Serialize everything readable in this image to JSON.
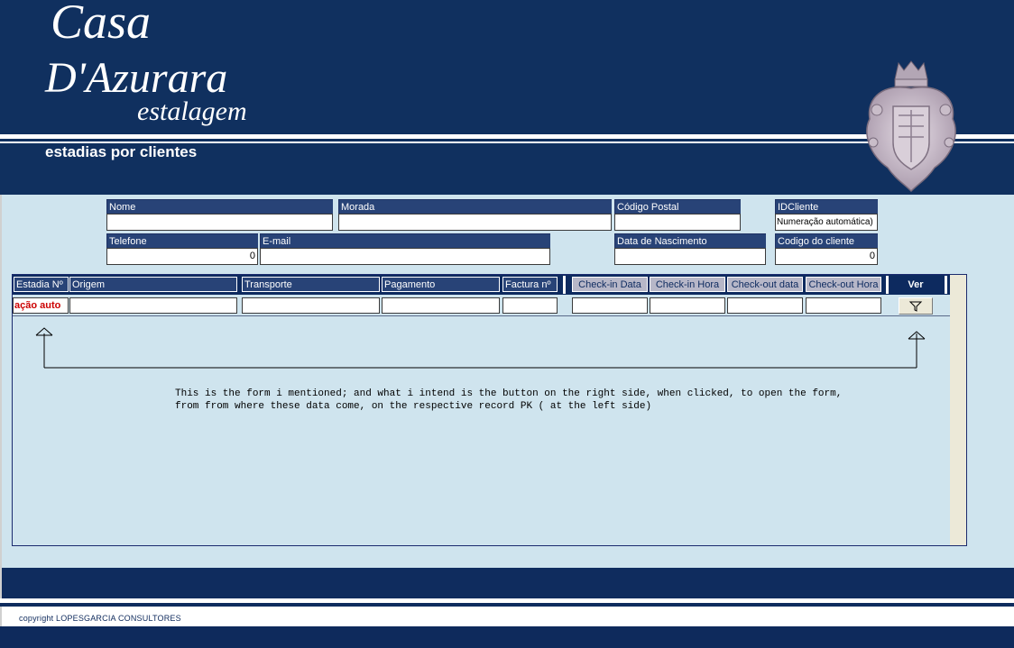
{
  "header": {
    "logo_line1": "Casa",
    "logo_line2": "D'Azurara",
    "logo_line3": "estalagem",
    "title": "estadias por clientes"
  },
  "client": {
    "nome": {
      "label": "Nome",
      "value": ""
    },
    "morada": {
      "label": "Morada",
      "value": ""
    },
    "codigo_postal": {
      "label": "Código Postal",
      "value": ""
    },
    "id_cliente": {
      "label": "IDCliente",
      "value": "Numeração automática)"
    },
    "telefone": {
      "label": "Telefone",
      "value": "0"
    },
    "email": {
      "label": "E-mail",
      "value": ""
    },
    "data_nascimento": {
      "label": "Data de Nascimento",
      "value": ""
    },
    "codigo_cliente": {
      "label": "Codigo do cliente",
      "value": "0"
    }
  },
  "subform": {
    "columns": {
      "estadia": "Estadia Nº",
      "origem": "Origem",
      "transporte": "Transporte",
      "pagamento": "Pagamento",
      "factura": "Factura nº",
      "checkin_data": "Check-in Data",
      "checkin_hora": "Check-in Hora",
      "checkout_data": "Check-out data",
      "checkout_hora": "Check-out Hora",
      "ver": "Ver"
    },
    "row": {
      "estadia": "ação auto",
      "origem": "",
      "transporte": "",
      "pagamento": "",
      "factura": "",
      "checkin_data": "",
      "checkin_hora": "",
      "checkout_data": "",
      "checkout_hora": ""
    },
    "filter_icon": "funnel-icon"
  },
  "annotation": {
    "text": "This is the form i mentioned; and what i intend is the button on the right side, when clicked, to open the form,\nfrom from where these data come, on the respective record PK ( at the left side)"
  },
  "footer": {
    "copyright": "copyright LOPESGARCIA CONSULTORES"
  },
  "colors": {
    "brand_navy": "#10305f",
    "panel_bg": "#cfe4ee",
    "label_bg": "#284377",
    "auto_text_red": "#cc0000"
  }
}
